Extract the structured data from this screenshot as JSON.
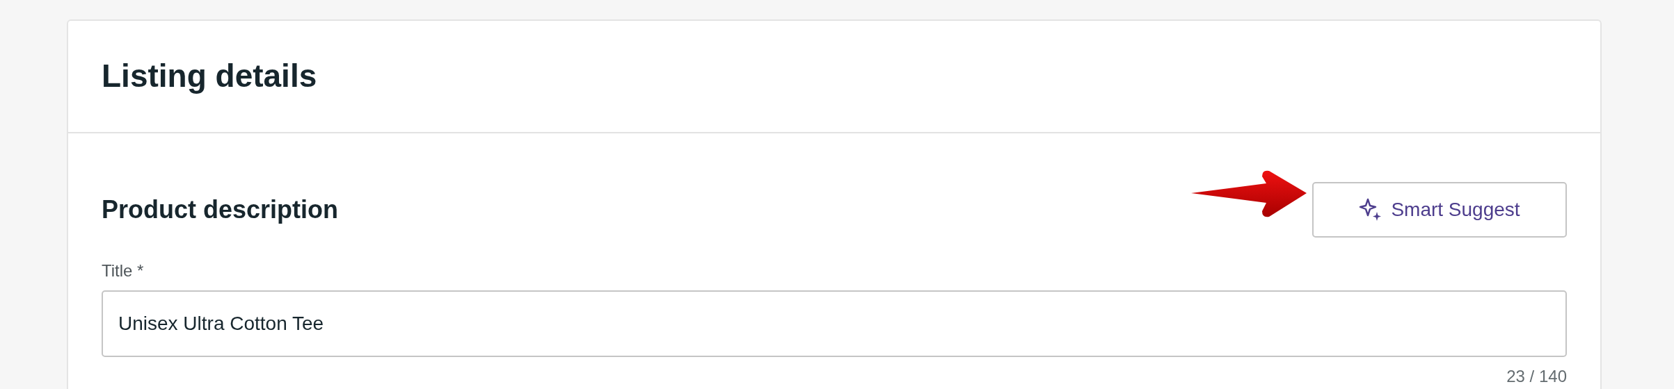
{
  "card": {
    "title": "Listing details"
  },
  "section": {
    "title": "Product description",
    "action_button": "Smart Suggest"
  },
  "title_field": {
    "label": "Title *",
    "value": "Unisex Ultra Cotton Tee",
    "counter": "23 / 140"
  }
}
